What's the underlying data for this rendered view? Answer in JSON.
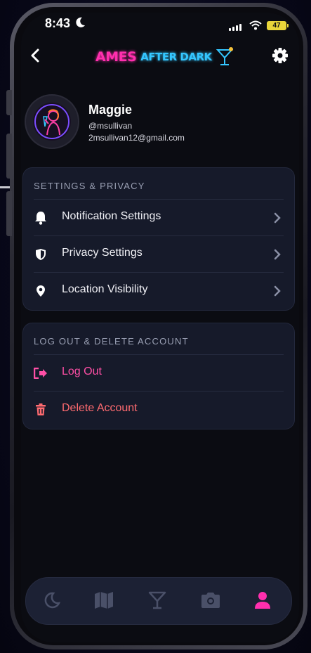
{
  "status_bar": {
    "time": "8:43",
    "battery": "47"
  },
  "header": {
    "logo_part1": "AMES",
    "logo_part2": "AFTER DARK"
  },
  "profile": {
    "name": "Maggie",
    "username": "@msullivan",
    "email": "2msullivan12@gmail.com"
  },
  "settings_section": {
    "title": "SETTINGS & PRIVACY",
    "items": [
      {
        "label": "Notification Settings",
        "icon": "bell-icon"
      },
      {
        "label": "Privacy Settings",
        "icon": "shield-icon"
      },
      {
        "label": "Location Visibility",
        "icon": "location-pin-icon"
      }
    ]
  },
  "account_section": {
    "title": "LOG OUT & DELETE ACCOUNT",
    "items": [
      {
        "label": "Log Out",
        "icon": "logout-icon"
      },
      {
        "label": "Delete Account",
        "icon": "trash-icon"
      }
    ]
  },
  "tab_bar": {
    "tabs": [
      {
        "icon": "moon-icon",
        "active": false
      },
      {
        "icon": "map-icon",
        "active": false
      },
      {
        "icon": "cocktail-icon",
        "active": false
      },
      {
        "icon": "camera-icon",
        "active": false
      },
      {
        "icon": "user-icon",
        "active": true
      }
    ]
  },
  "colors": {
    "accent_pink": "#ff2fae",
    "accent_blue": "#34c6ff",
    "danger": "#ff6b70",
    "card_bg": "#161a2a",
    "inactive_tab": "#4a5068"
  }
}
